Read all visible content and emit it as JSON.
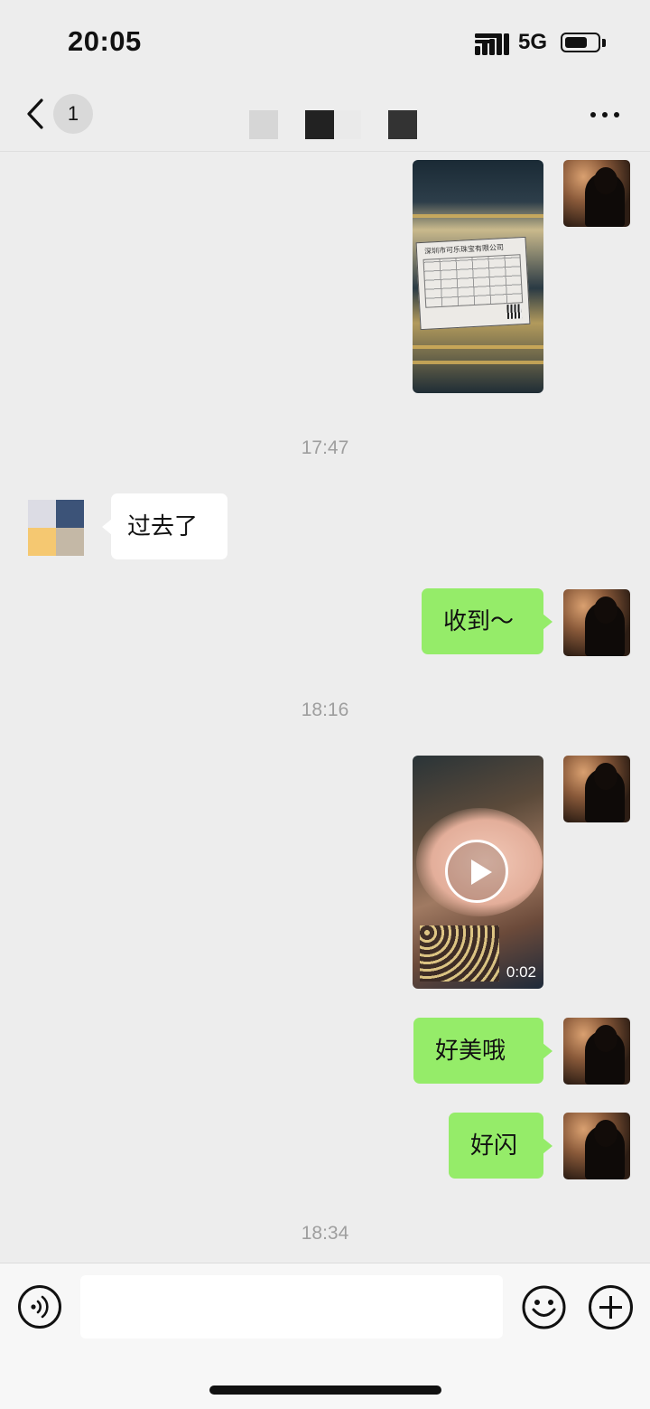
{
  "status_bar": {
    "time": "20:05",
    "network": "5G",
    "battery_level": 0.7
  },
  "nav": {
    "unread_count": "1",
    "icons": {
      "back": "chevron-left-icon",
      "more": "more-horizontal-icon"
    }
  },
  "messages": [
    {
      "type": "image",
      "from": "me",
      "description_icon": "photo"
    },
    {
      "type": "time",
      "text": "17:47"
    },
    {
      "type": "text",
      "from": "other",
      "text": "过去了"
    },
    {
      "type": "text",
      "from": "me",
      "text": "收到～"
    },
    {
      "type": "time",
      "text": "18:16"
    },
    {
      "type": "video",
      "from": "me",
      "duration": "0:02"
    },
    {
      "type": "text",
      "from": "me",
      "text": "好美哦"
    },
    {
      "type": "text",
      "from": "me",
      "text": "好闪"
    },
    {
      "type": "time",
      "text": "18:34"
    }
  ],
  "receipt_header": "深圳市可乐珠宝有限公司",
  "input_bar": {
    "placeholder": "",
    "icons": {
      "voice": "voice-icon",
      "emoji": "emoji-icon",
      "plus": "plus-icon"
    }
  },
  "colors": {
    "background": "#ededed",
    "my_bubble": "#95ec69",
    "other_bubble": "#ffffff",
    "timestamp": "#9e9e9e"
  }
}
